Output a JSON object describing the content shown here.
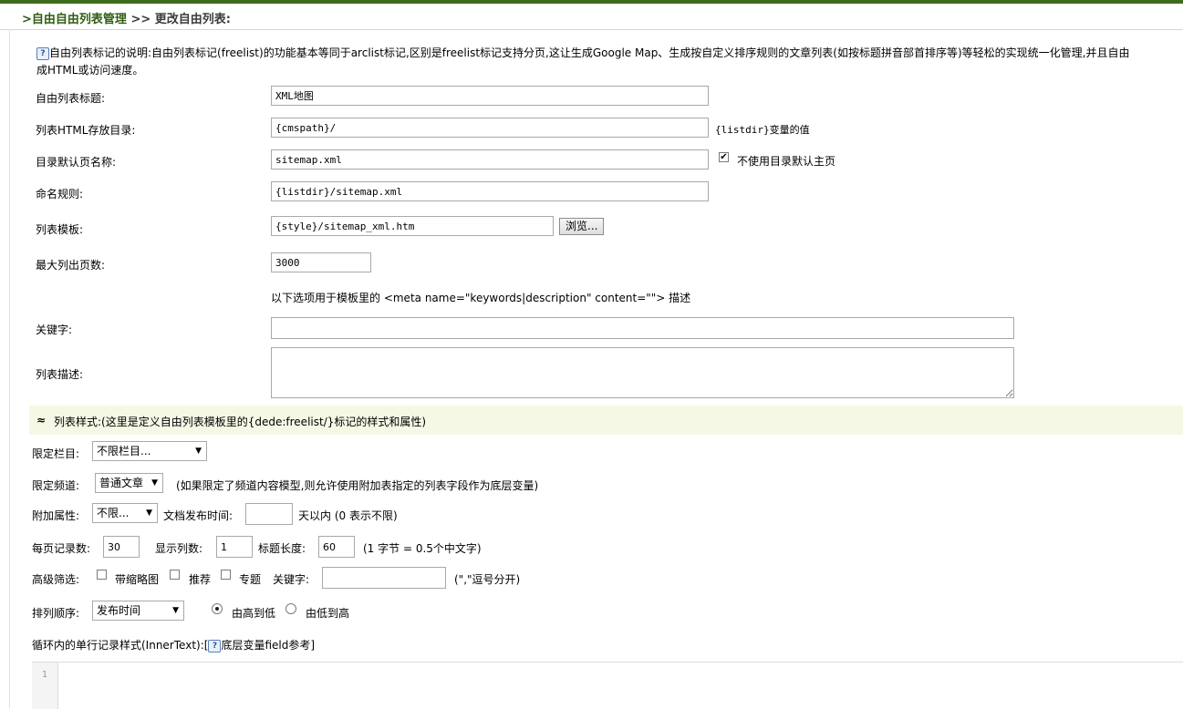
{
  "breadcrumb": {
    "section": ">自由自由列表管理",
    "separator": ">>",
    "current": "更改自由列表:"
  },
  "description": {
    "line1": "自由列表标记的说明:自由列表标记(freelist)的功能基本等同于arclist标记,区别是freelist标记支持分页,这让生成Google Map、生成按自定义排序规则的文章列表(如按标题拼音部首排序等)等轻松的实现统一化管理,并且自由",
    "line2": "成HTML或访问速度。"
  },
  "form": {
    "title_label": "自由列表标题:",
    "title_value": "XML地图",
    "dir_label": "列表HTML存放目录:",
    "dir_value": "{cmspath}/",
    "dir_hint": "{listdir}变量的值",
    "default_page_label": "目录默认页名称:",
    "default_page_value": "sitemap.xml",
    "no_default_label": "不使用目录默认主页",
    "naming_label": "命名规则:",
    "naming_value": "{listdir}/sitemap.xml",
    "template_label": "列表模板:",
    "template_value": "{style}/sitemap_xml.htm",
    "browse_label": "浏览...",
    "max_pages_label": "最大列出页数:",
    "max_pages_value": "3000",
    "meta_note": "以下选项用于模板里的 <meta name=\"keywords|description\" content=\"\"> 描述",
    "keywords_label": "关键字:",
    "desc_label": "列表描述:"
  },
  "style_bar": {
    "toggle": "≈",
    "text": "列表样式:(这里是定义自由列表模板里的{dede:freelist/}标记的样式和属性)"
  },
  "filters": {
    "column_label": "限定栏目:",
    "column_value": "不限栏目...",
    "channel_label": "限定频道:",
    "channel_value": "普通文章",
    "channel_hint": "(如果限定了频道内容模型,则允许使用附加表指定的列表字段作为底层变量)",
    "attr_label": "附加属性:",
    "attr_value": "不限...",
    "pubtime_label": "文档发布时间:",
    "pubtime_value": "",
    "pubtime_suffix": "天以内 (0 表示不限)",
    "per_page_label": "每页记录数:",
    "per_page_value": "30",
    "cols_label": "显示列数:",
    "cols_value": "1",
    "title_len_label": "标题长度:",
    "title_len_value": "60",
    "title_len_hint": "(1 字节 = 0.5个中文字)",
    "advanced_label": "高级筛选:",
    "thumb_label": "带缩略图",
    "recommend_label": "推荐",
    "topic_label": "专题",
    "keyword_label": "关键字:",
    "keyword_value": "",
    "keyword_hint": "(\",\"逗号分开)",
    "order_label": "排列顺序:",
    "order_value": "发布时间",
    "desc_order_label": "由高到低",
    "asc_order_label": "由低到高",
    "innertext_label": "循环内的单行记录样式(InnerText):[",
    "field_ref_label": "底层变量field参考]"
  },
  "editor": {
    "line_no": "1"
  }
}
